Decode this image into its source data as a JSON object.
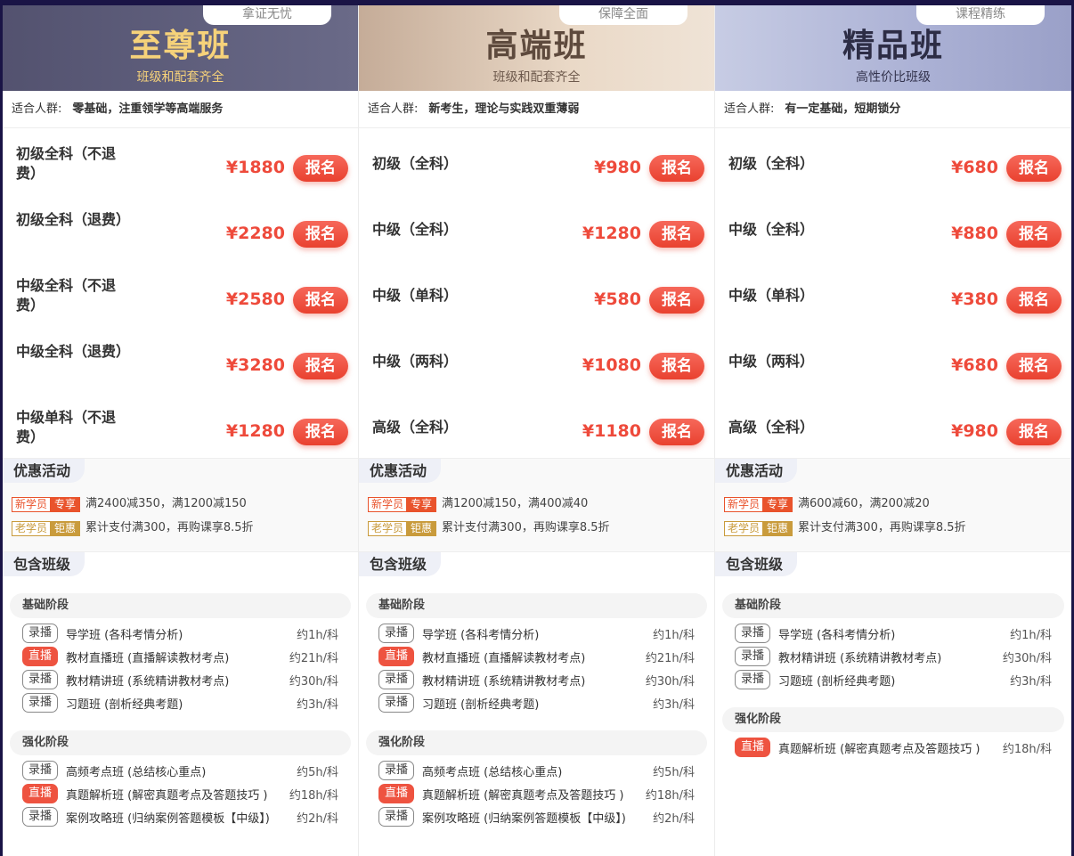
{
  "columns": [
    {
      "tag": "拿证无忧",
      "title": "至尊班",
      "subtitle": "班级和配套齐全",
      "suit_label": "适合人群:",
      "suit_text": "零基础，注重领学等高端服务",
      "courses": [
        {
          "name": "初级全科（不退费）",
          "price": "¥1880",
          "btn": "报名"
        },
        {
          "name": "初级全科（退费）",
          "price": "¥2280",
          "btn": "报名"
        },
        {
          "name": "中级全科（不退费）",
          "price": "¥2580",
          "btn": "报名"
        },
        {
          "name": "中级全科（退费）",
          "price": "¥3280",
          "btn": "报名"
        },
        {
          "name": "中级单科（不退费）",
          "price": "¥1280",
          "btn": "报名"
        }
      ],
      "promo_title": "优惠活动",
      "promo_new_a": "新学员",
      "promo_new_b": "专享",
      "promo_new_text": "满2400减350，满1200减150",
      "promo_old_a": "老学员",
      "promo_old_b": "钜惠",
      "promo_old_text": "累计支付满300，再购课享8.5折",
      "incl_title": "包含班级",
      "stages": [
        {
          "name": "基础阶段",
          "items": [
            {
              "mode": "录播",
              "live": false,
              "name": "导学班 (各科考情分析)",
              "hours": "约1h/科"
            },
            {
              "mode": "直播",
              "live": true,
              "name": "教材直播班 (直播解读教材考点)",
              "hours": "约21h/科"
            },
            {
              "mode": "录播",
              "live": false,
              "name": "教材精讲班 (系统精讲教材考点)",
              "hours": "约30h/科"
            },
            {
              "mode": "录播",
              "live": false,
              "name": "习题班 (剖析经典考题)",
              "hours": "约3h/科"
            }
          ]
        },
        {
          "name": "强化阶段",
          "items": [
            {
              "mode": "录播",
              "live": false,
              "name": "高频考点班 (总结核心重点)",
              "hours": "约5h/科"
            },
            {
              "mode": "直播",
              "live": true,
              "name": "真题解析班 (解密真题考点及答题技巧 )",
              "hours": "约18h/科"
            },
            {
              "mode": "录播",
              "live": false,
              "name": "案例攻略班 (归纳案例答题模板【中级】)",
              "hours": "约2h/科"
            }
          ]
        }
      ]
    },
    {
      "tag": "保障全面",
      "title": "高端班",
      "subtitle": "班级和配套齐全",
      "suit_label": "适合人群:",
      "suit_text": "新考生，理论与实践双重薄弱",
      "courses": [
        {
          "name": "初级（全科）",
          "price": "¥980",
          "btn": "报名"
        },
        {
          "name": "中级（全科）",
          "price": "¥1280",
          "btn": "报名"
        },
        {
          "name": "中级（单科）",
          "price": "¥580",
          "btn": "报名"
        },
        {
          "name": "中级（两科）",
          "price": "¥1080",
          "btn": "报名"
        },
        {
          "name": "高级（全科）",
          "price": "¥1180",
          "btn": "报名"
        }
      ],
      "promo_title": "优惠活动",
      "promo_new_a": "新学员",
      "promo_new_b": "专享",
      "promo_new_text": "满1200减150，满400减40",
      "promo_old_a": "老学员",
      "promo_old_b": "钜惠",
      "promo_old_text": "累计支付满300，再购课享8.5折",
      "incl_title": "包含班级",
      "stages": [
        {
          "name": "基础阶段",
          "items": [
            {
              "mode": "录播",
              "live": false,
              "name": "导学班 (各科考情分析)",
              "hours": "约1h/科"
            },
            {
              "mode": "直播",
              "live": true,
              "name": "教材直播班 (直播解读教材考点)",
              "hours": "约21h/科"
            },
            {
              "mode": "录播",
              "live": false,
              "name": "教材精讲班 (系统精讲教材考点)",
              "hours": "约30h/科"
            },
            {
              "mode": "录播",
              "live": false,
              "name": "习题班 (剖析经典考题)",
              "hours": "约3h/科"
            }
          ]
        },
        {
          "name": "强化阶段",
          "items": [
            {
              "mode": "录播",
              "live": false,
              "name": "高频考点班 (总结核心重点)",
              "hours": "约5h/科"
            },
            {
              "mode": "直播",
              "live": true,
              "name": "真题解析班 (解密真题考点及答题技巧 )",
              "hours": "约18h/科"
            },
            {
              "mode": "录播",
              "live": false,
              "name": "案例攻略班 (归纳案例答题模板【中级】)",
              "hours": "约2h/科"
            }
          ]
        }
      ]
    },
    {
      "tag": "课程精练",
      "title": "精品班",
      "subtitle": "高性价比班级",
      "suit_label": "适合人群:",
      "suit_text": "有一定基础，短期锁分",
      "courses": [
        {
          "name": "初级（全科）",
          "price": "¥680",
          "btn": "报名"
        },
        {
          "name": "中级（全科）",
          "price": "¥880",
          "btn": "报名"
        },
        {
          "name": "中级（单科）",
          "price": "¥380",
          "btn": "报名"
        },
        {
          "name": "中级（两科）",
          "price": "¥680",
          "btn": "报名"
        },
        {
          "name": "高级（全科）",
          "price": "¥980",
          "btn": "报名"
        }
      ],
      "promo_title": "优惠活动",
      "promo_new_a": "新学员",
      "promo_new_b": "专享",
      "promo_new_text": "满600减60，满200减20",
      "promo_old_a": "老学员",
      "promo_old_b": "钜惠",
      "promo_old_text": "累计支付满300，再购课享8.5折",
      "incl_title": "包含班级",
      "stages": [
        {
          "name": "基础阶段",
          "items": [
            {
              "mode": "录播",
              "live": false,
              "name": "导学班 (各科考情分析)",
              "hours": "约1h/科"
            },
            {
              "mode": "录播",
              "live": false,
              "name": "教材精讲班 (系统精讲教材考点)",
              "hours": "约30h/科"
            },
            {
              "mode": "录播",
              "live": false,
              "name": "习题班 (剖析经典考题)",
              "hours": "约3h/科"
            }
          ]
        },
        {
          "name": "强化阶段",
          "items": [
            {
              "mode": "直播",
              "live": true,
              "name": "真题解析班 (解密真题考点及答题技巧 )",
              "hours": "约18h/科"
            }
          ]
        }
      ]
    }
  ]
}
